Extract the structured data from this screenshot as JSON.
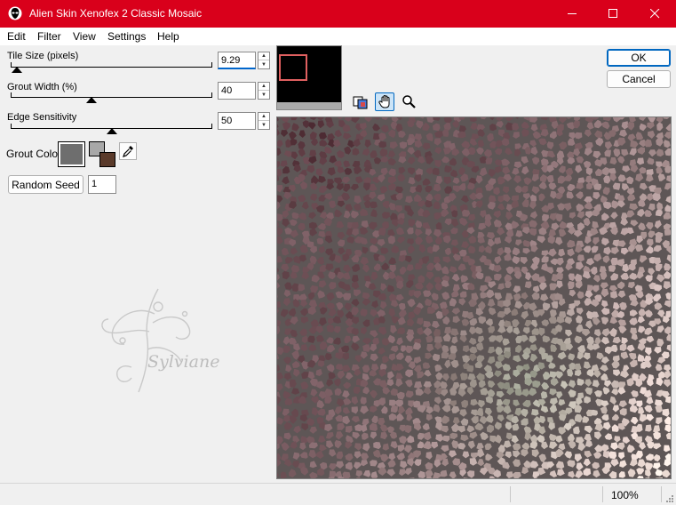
{
  "window": {
    "title": "Alien Skin Xenofex 2 Classic Mosaic",
    "accent": "#d9001b"
  },
  "menu": [
    "Edit",
    "Filter",
    "View",
    "Settings",
    "Help"
  ],
  "controls": {
    "tile_size": {
      "label": "Tile Size (pixels)",
      "value": "9.29",
      "level": 0.03
    },
    "grout_width": {
      "label": "Grout Width (%)",
      "value": "40",
      "level": 0.4
    },
    "edge_sensitivity": {
      "label": "Edge Sensitivity",
      "value": "50",
      "level": 0.5
    },
    "grout_color": {
      "label": "Grout Color",
      "color": "#6e6e6e",
      "fg_color": "#a8a8a8",
      "bg_color": "#5a3a2a"
    },
    "random_seed": {
      "button_label": "Random Seed",
      "value": "1"
    }
  },
  "buttons": {
    "ok": "OK",
    "cancel": "Cancel"
  },
  "tools": [
    "compare-icon",
    "hand-icon",
    "zoom-icon"
  ],
  "watermark": {
    "text": "Sylviane"
  },
  "status": {
    "zoom": "100%"
  }
}
